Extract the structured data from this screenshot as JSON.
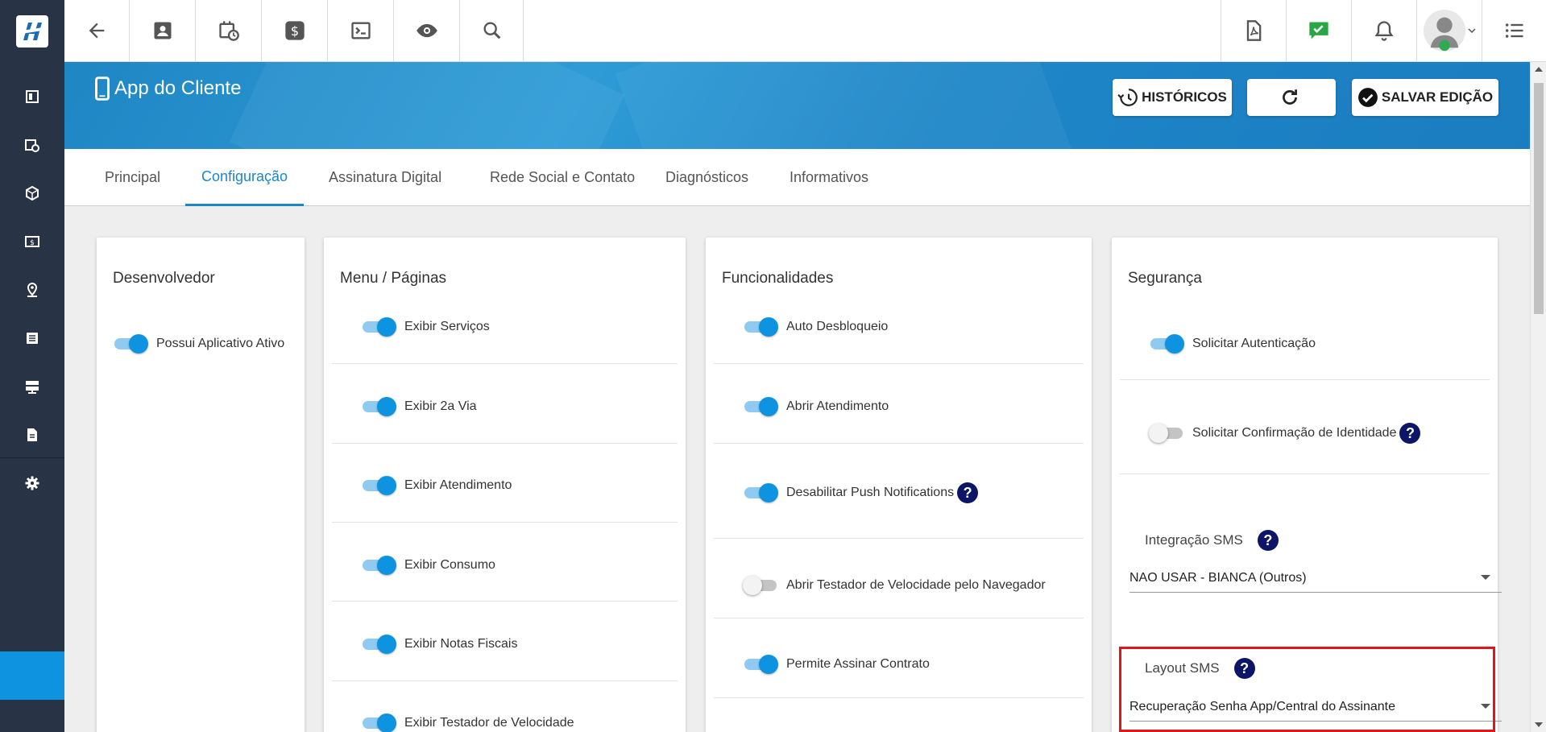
{
  "colors": {
    "sidebar": "#283345",
    "accent": "#0e93e0",
    "banner": "#1f86c4",
    "highlight_box": "#e0161b",
    "help_icon": "#0d1566"
  },
  "toolbar": {
    "left_icons": [
      "back-arrow-icon",
      "contact-card-icon",
      "calendar-clock-icon",
      "dollar-icon",
      "terminal-icon",
      "eye-icon",
      "search-icon"
    ],
    "right_icons": [
      "pdf-icon",
      "chat-check-icon",
      "bell-icon",
      "user-avatar",
      "list-menu-icon"
    ]
  },
  "sidebar": {
    "items": [
      "dashboard-icon",
      "calendar-clock-icon",
      "box-icon",
      "money-icon",
      "location-icon",
      "list-icon",
      "server-icon",
      "document-icon",
      "gear-icon"
    ]
  },
  "banner": {
    "title": "App do Cliente",
    "historicos_label": "HISTÓRICOS",
    "salvar_label": "SALVAR EDIÇÃO"
  },
  "tabs": [
    {
      "label": "Principal",
      "active": false
    },
    {
      "label": "Configuração",
      "active": true
    },
    {
      "label": "Assinatura Digital",
      "active": false
    },
    {
      "label": "Rede Social e Contato",
      "active": false
    },
    {
      "label": "Diagnósticos",
      "active": false
    },
    {
      "label": "Informativos",
      "active": false
    }
  ],
  "desenvolvedor": {
    "title": "Desenvolvedor",
    "items": [
      {
        "label": "Possui Aplicativo Ativo",
        "on": true
      }
    ]
  },
  "menu": {
    "title": "Menu / Páginas",
    "items": [
      {
        "label": "Exibir Serviços",
        "on": true
      },
      {
        "label": "Exibir 2a Via",
        "on": true
      },
      {
        "label": "Exibir Atendimento",
        "on": true
      },
      {
        "label": "Exibir Consumo",
        "on": true
      },
      {
        "label": "Exibir Notas Fiscais",
        "on": true
      },
      {
        "label": "Exibir Testador de Velocidade",
        "on": true
      }
    ]
  },
  "funcionalidades": {
    "title": "Funcionalidades",
    "items": [
      {
        "label": "Auto Desbloqueio",
        "on": true
      },
      {
        "label": "Abrir Atendimento",
        "on": true
      },
      {
        "label": "Desabilitar Push Notifications",
        "on": true,
        "help": true
      },
      {
        "label": "Abrir Testador de Velocidade pelo Navegador",
        "on": false
      },
      {
        "label": "Permite Assinar Contrato",
        "on": true
      }
    ]
  },
  "seguranca": {
    "title": "Segurança",
    "items": [
      {
        "label": "Solicitar Autenticação",
        "on": true
      },
      {
        "label": "Solicitar Confirmação de Identidade",
        "on": false,
        "help": true
      }
    ],
    "integracao_sms_label": "Integração SMS",
    "integracao_sms_value": "NAO USAR - BIANCA (Outros)",
    "layout_sms_label": "Layout SMS",
    "layout_sms_value": "Recuperação Senha App/Central do Assinante"
  },
  "help_symbol": "?"
}
